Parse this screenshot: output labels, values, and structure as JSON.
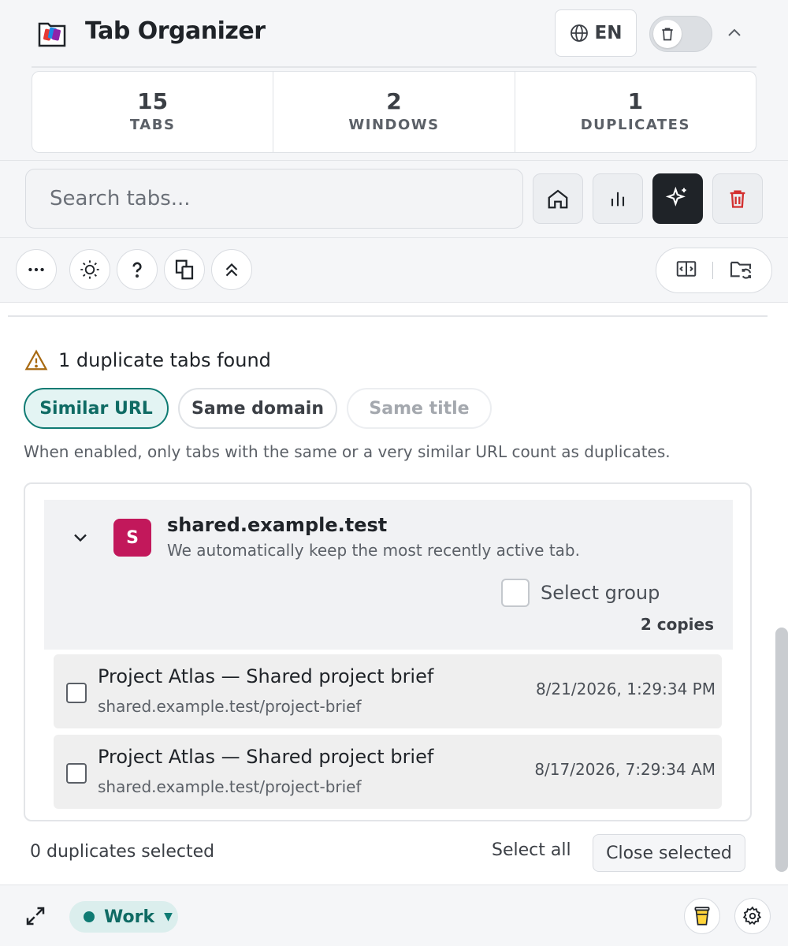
{
  "header": {
    "title": "Tab Organizer",
    "language": "EN"
  },
  "stats": [
    {
      "value": "15",
      "label": "TABS"
    },
    {
      "value": "2",
      "label": "WINDOWS"
    },
    {
      "value": "1",
      "label": "DUPLICATES"
    }
  ],
  "search": {
    "placeholder": "Search tabs..."
  },
  "duplicates": {
    "found_text": "1 duplicate tabs found",
    "filters": [
      {
        "label": "Similar URL",
        "state": "active"
      },
      {
        "label": "Same domain",
        "state": "normal"
      },
      {
        "label": "Same title",
        "state": "disabled"
      }
    ],
    "hint": "When enabled, only tabs with the same or a very similar URL count as duplicates.",
    "group": {
      "avatar_letter": "S",
      "avatar_color": "#c2185b",
      "domain": "shared.example.test",
      "note": "We automatically keep the most recently active tab.",
      "select_group_label": "Select group",
      "copies": "2 copies",
      "tabs": [
        {
          "title": "Project Atlas — Shared project brief",
          "url": "shared.example.test/project-brief",
          "time": "8/21/2026, 1:29:34 PM"
        },
        {
          "title": "Project Atlas — Shared project brief",
          "url": "shared.example.test/project-brief",
          "time": "8/17/2026, 7:29:34 AM"
        }
      ]
    },
    "selected_count": "0 duplicates selected",
    "select_all": "Select all",
    "close_selected": "Close selected"
  },
  "footer": {
    "workspace": "Work",
    "workspace_color": "#0f7b73"
  },
  "colors": {
    "accent": "#0f7b73",
    "danger": "#d32f2f",
    "warning": "#a86a12"
  }
}
